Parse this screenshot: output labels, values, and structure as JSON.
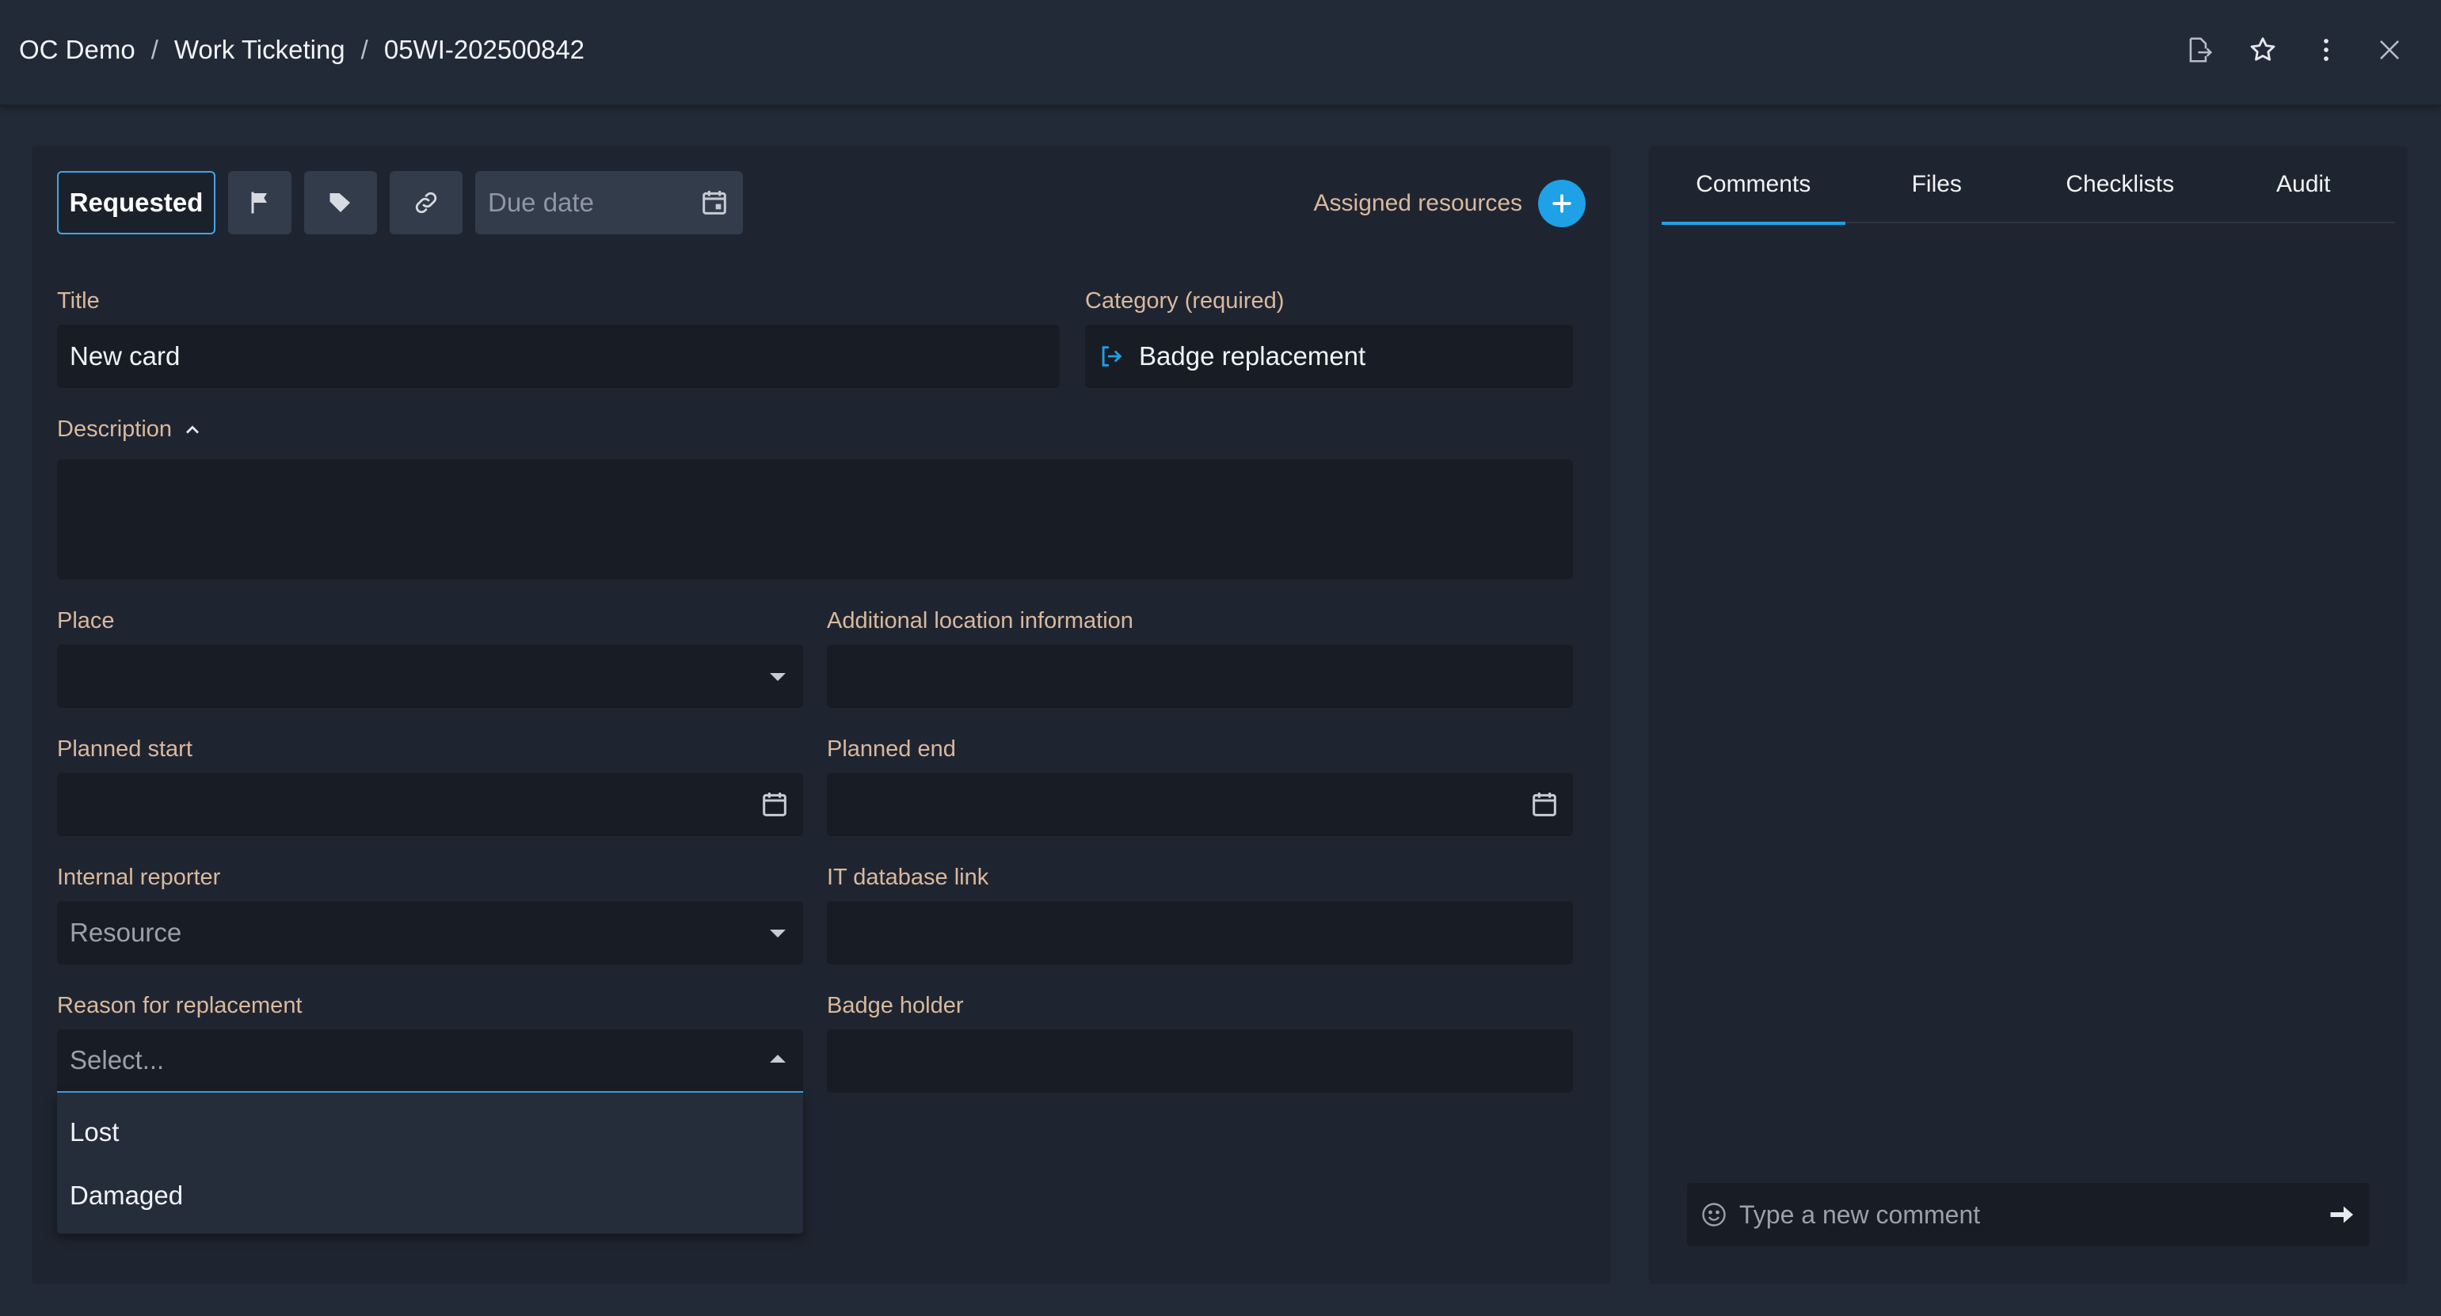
{
  "breadcrumb": {
    "items": [
      "OC Demo",
      "Work Ticketing",
      "05WI-202500842"
    ],
    "separator": "/"
  },
  "header_actions": [
    "export-icon",
    "star-icon",
    "more-vertical-icon",
    "close-icon"
  ],
  "toolbar": {
    "status": "Requested",
    "due_date_placeholder": "Due date",
    "assigned_resources": "Assigned resources"
  },
  "form": {
    "title_label": "Title",
    "title_value": "New card",
    "category_label": "Category  (required)",
    "category_value": "Badge replacement",
    "description_label": "Description",
    "place_label": "Place",
    "additional_location_label": "Additional location information",
    "planned_start_label": "Planned start",
    "planned_end_label": "Planned end",
    "internal_reporter_label": "Internal reporter",
    "internal_reporter_placeholder": "Resource",
    "it_database_link_label": "IT database link",
    "reason_label": "Reason for replacement",
    "reason_placeholder": "Select...",
    "reason_options": [
      "Lost",
      "Damaged"
    ],
    "badge_holder_label": "Badge holder"
  },
  "side_panel": {
    "tabs": [
      "Comments",
      "Files",
      "Checklists",
      "Audit"
    ],
    "active_tab": "Comments",
    "comment_placeholder": "Type a new comment"
  },
  "colors": {
    "accent": "#1ea1e6",
    "label": "#d9b99e",
    "background": "#232a37",
    "panel": "#1f2530",
    "input": "#181d25"
  }
}
